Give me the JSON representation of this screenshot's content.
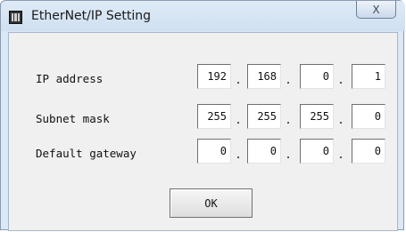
{
  "window": {
    "title": "EtherNet/IP Setting",
    "close_label": "X"
  },
  "fields": [
    {
      "label": "IP address",
      "octets": [
        "192",
        "168",
        "0",
        "1"
      ]
    },
    {
      "label": "Subnet mask",
      "octets": [
        "255",
        "255",
        "255",
        "0"
      ]
    },
    {
      "label": "Default gateway",
      "octets": [
        "0",
        "0",
        "0",
        "0"
      ]
    }
  ],
  "separator": ".",
  "ok_label": "OK"
}
